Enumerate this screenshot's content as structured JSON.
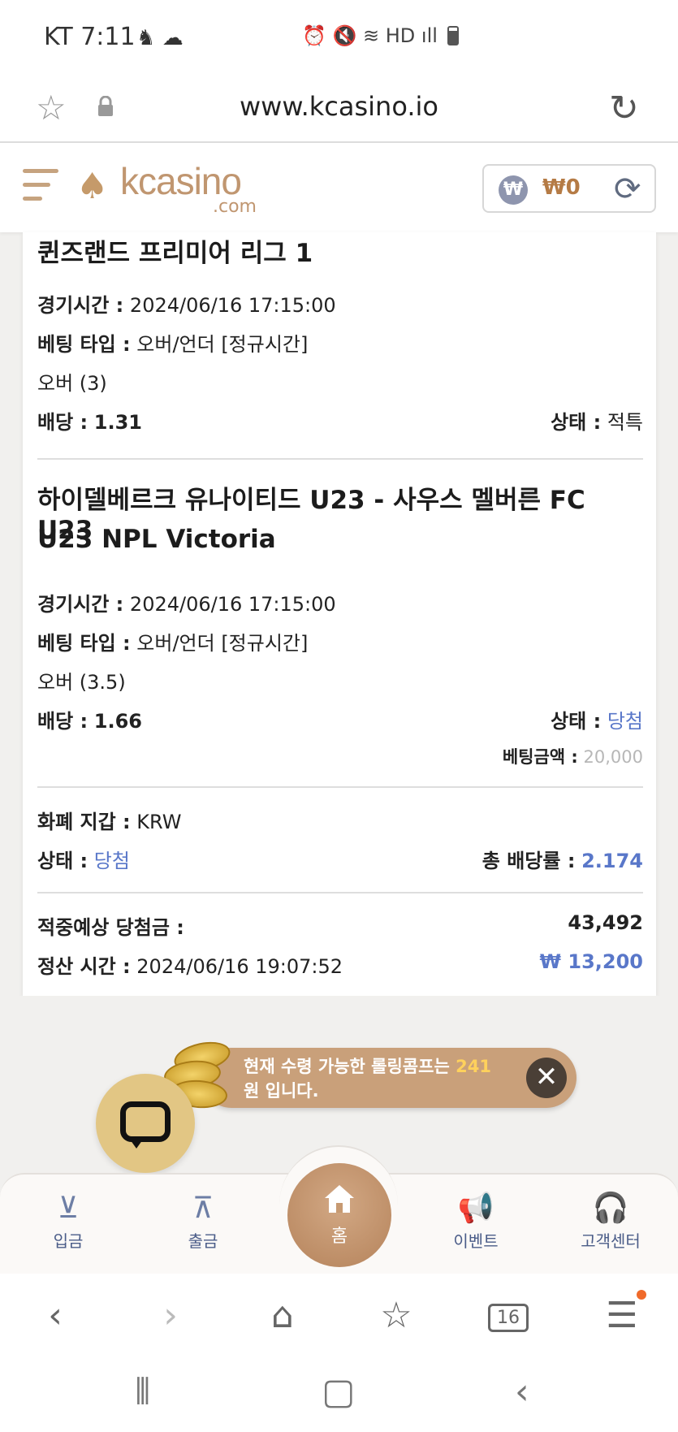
{
  "status_bar": {
    "time": "KT 7:11",
    "left_icons": "♞ ☁",
    "right_icons": "⏰ 🔇 ≋ HD ıll"
  },
  "url_bar": {
    "url": "www.kcasino.io"
  },
  "header": {
    "logo_text": "kcasino",
    "logo_sub": ".com",
    "wallet_symbol": "₩",
    "wallet_amount": "₩0"
  },
  "bets": [
    {
      "title": "퀸즈랜드 프리미어 리그 1",
      "time_label": "경기시간 :",
      "time": "2024/06/16 17:15:00",
      "type_label": "베팅 타입 :",
      "type": "오버/언더 [정규시간]",
      "pick": "오버 (3)",
      "odds_label": "배당 :",
      "odds": "1.31",
      "status_label": "상태 :",
      "status": "적특"
    },
    {
      "title_line1": "하이델베르크 유나이티드 U23 - 사우스 멜버른 FC U23",
      "title_line2": "U23 NPL Victoria",
      "time_label": "경기시간 :",
      "time": "2024/06/16 17:15:00",
      "type_label": "베팅 타입 :",
      "type": "오버/언더 [정규시간]",
      "pick": "오버 (3.5)",
      "odds_label": "배당 :",
      "odds": "1.66",
      "status_label": "상태 :",
      "status": "당첨",
      "amount_label": "베팅금액 :",
      "amount": "20,000"
    }
  ],
  "summary": {
    "currency_label": "화폐 지갑 :",
    "currency": "KRW",
    "status_label": "상태 :",
    "status": "당첨",
    "total_odds_label": "총 배당률 :",
    "total_odds": "2.174",
    "expected_label": "적중예상 당첨금 :",
    "expected": "43,492",
    "settle_label": "정산 시간 :",
    "settle_time": "2024/06/16 19:07:52",
    "payout": "₩ 13,200"
  },
  "promo": {
    "text_before": "현재 수령 가능한 롤링콤프는 ",
    "amount": "241",
    "text_after": " 원 입니다.",
    "close": "✕"
  },
  "tabbar": {
    "deposit": "입금",
    "withdraw": "출금",
    "home": "홈",
    "event": "이벤트",
    "support": "고객센터"
  },
  "browser_nav": {
    "tabs_count": "16"
  }
}
